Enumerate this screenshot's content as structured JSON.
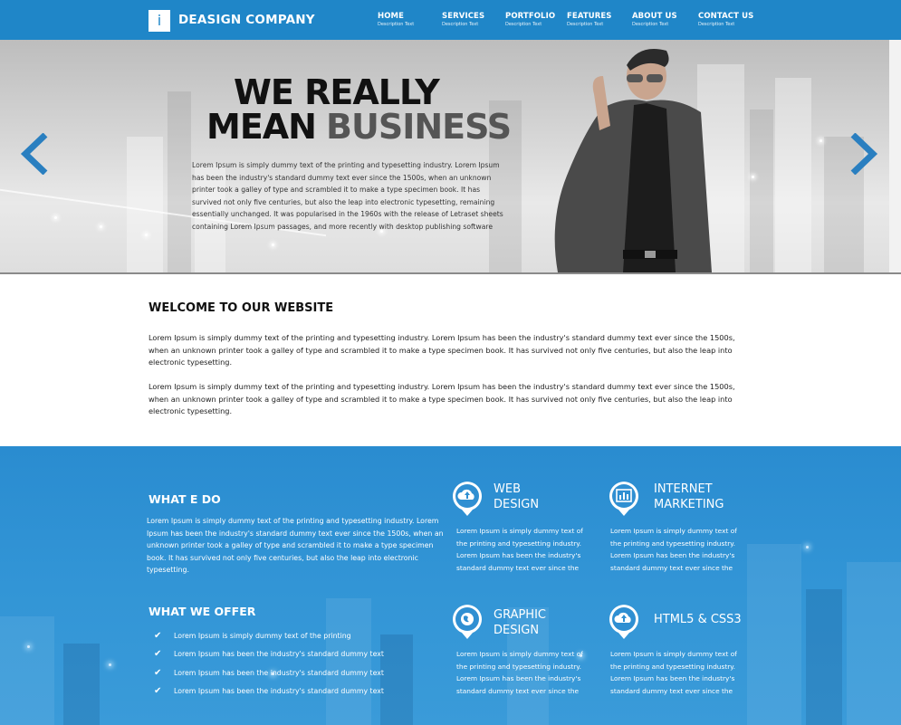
{
  "header": {
    "logo_letter": "i",
    "company": "DEASIGN COMPANY",
    "nav": [
      {
        "label": "HOME",
        "desc": "Description Text"
      },
      {
        "label": "SERVICES",
        "desc": "Description Text"
      },
      {
        "label": "PORTFOLIO",
        "desc": "Description Text"
      },
      {
        "label": "FEATURES",
        "desc": "Description Text"
      },
      {
        "label": "ABOUT US",
        "desc": "Description Text"
      },
      {
        "label": "CONTACT US",
        "desc": "Description Text"
      }
    ]
  },
  "hero": {
    "title_line1": "WE REALLY",
    "title_line2_a": "MEAN",
    "title_line2_b": "BUSINESS",
    "body": "Lorem Ipsum is simply dummy text of the printing and typesetting industry. Lorem Ipsum has been the industry's standard dummy text ever since the 1500s, when an unknown printer took a galley of type and scrambled it to make a type specimen book. It has survived not only five centuries, but also the leap into electronic typesetting, remaining essentially unchanged. It was popularised in the 1960s with the release of Letraset sheets containing Lorem Ipsum passages, and more recently with desktop publishing software"
  },
  "welcome": {
    "title": "WELCOME TO OUR WEBSITE",
    "p1": "Lorem Ipsum is simply dummy text of the printing and typesetting industry. Lorem Ipsum has been the industry's standard dummy text ever since the 1500s, when an unknown printer took a galley of type and scrambled it to make a type specimen book. It has survived not only five centuries, but also the leap into electronic typesetting.",
    "p2": "Lorem Ipsum is simply dummy text of the printing and typesetting industry. Lorem Ipsum has been the industry's standard dummy text ever since the 1500s, when an unknown printer took a galley of type and scrambled it to make a type specimen book. It has survived not only five centuries, but also the leap into electronic typesetting."
  },
  "what_we_do": {
    "title": "WHAT E DO",
    "body": "Lorem Ipsum is simply dummy text of the printing and typesetting industry. Lorem Ipsum has been the industry's standard dummy text ever since the 1500s, when an unknown printer took a galley of type and scrambled it to make a type specimen book. It has survived not only five centuries, but also the leap into electronic typesetting."
  },
  "what_we_offer": {
    "title": "WHAT WE OFFER",
    "items": [
      "Lorem Ipsum is simply dummy text of the printing",
      "Lorem Ipsum has been the industry's standard dummy text",
      "Lorem Ipsum has been the industry's standard dummy text",
      "Lorem Ipsum has been the industry's standard dummy text"
    ]
  },
  "services": [
    {
      "title1": "WEB",
      "title2": "DESIGN",
      "icon": "cloud-upload-icon",
      "body": "Lorem Ipsum is simply dummy text of the printing and typesetting industry. Lorem Ipsum has been the industry's standard dummy text ever since the"
    },
    {
      "title1": "INTERNET",
      "title2": "MARKETING",
      "icon": "chart-icon",
      "body": "Lorem Ipsum is simply dummy text of the printing and typesetting industry. Lorem Ipsum has been the industry's standard dummy text ever since the"
    },
    {
      "title1": "GRAPHIC",
      "title2": "DESIGN",
      "icon": "globe-icon",
      "body": "Lorem Ipsum is simply dummy text of the printing and typesetting industry. Lorem Ipsum has been the industry's standard dummy text ever since the"
    },
    {
      "title1": "HTML5 & CSS3",
      "title2": "",
      "icon": "cloud-upload-icon",
      "body": "Lorem Ipsum is simply dummy text of the printing and typesetting industry. Lorem Ipsum has been the industry's standard dummy text ever since the"
    }
  ],
  "colors": {
    "header_blue": "#1f86c8",
    "section_blue": "#3295d6",
    "arrow_blue": "#2a7fc0"
  }
}
